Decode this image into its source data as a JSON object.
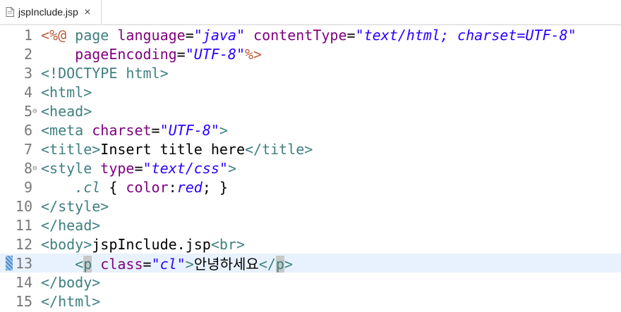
{
  "tab": {
    "label": "jspInclude.jsp",
    "close_glyph": "✕",
    "file_icon": "jsp-file-icon"
  },
  "lines": [
    {
      "n": "1"
    },
    {
      "n": "2"
    },
    {
      "n": "3"
    },
    {
      "n": "4"
    },
    {
      "n": "5",
      "fold": "⊖"
    },
    {
      "n": "6"
    },
    {
      "n": "7"
    },
    {
      "n": "8",
      "fold": "⊖"
    },
    {
      "n": "9"
    },
    {
      "n": "10"
    },
    {
      "n": "11"
    },
    {
      "n": "12"
    },
    {
      "n": "13"
    },
    {
      "n": "14"
    },
    {
      "n": "15"
    }
  ],
  "code": {
    "l1": [
      "<%@",
      " page",
      " language",
      "=",
      "\"java\"",
      " contentType",
      "=",
      "\"text/html; charset=UTF-8\""
    ],
    "l2": [
      "    ",
      "pageEncoding",
      "=",
      "\"UTF-8\"",
      "%>"
    ],
    "l3": [
      "<!DOCTYPE",
      " html",
      ">"
    ],
    "l4": [
      "<html>"
    ],
    "l5": [
      "<head>"
    ],
    "l6": [
      "<meta",
      " charset",
      "=",
      "\"UTF-8\"",
      ">"
    ],
    "l7": [
      "<title>",
      "Insert title here",
      "</title>"
    ],
    "l8": [
      "<style",
      " type",
      "=",
      "\"text/css\"",
      ">"
    ],
    "l9": [
      "    ",
      ".cl",
      " { ",
      "color",
      ":",
      "red",
      "; }"
    ],
    "l10": [
      "</style>"
    ],
    "l11": [
      "</head>"
    ],
    "l12": [
      "<body>",
      "jspInclude.jsp",
      "<br>"
    ],
    "l13": [
      "    ",
      "<",
      "p",
      " class",
      "=",
      "\"cl\"",
      ">",
      "안녕하세요",
      "</",
      "p",
      ">"
    ],
    "l14": [
      "</body>"
    ],
    "l15": [
      "</html>"
    ]
  }
}
